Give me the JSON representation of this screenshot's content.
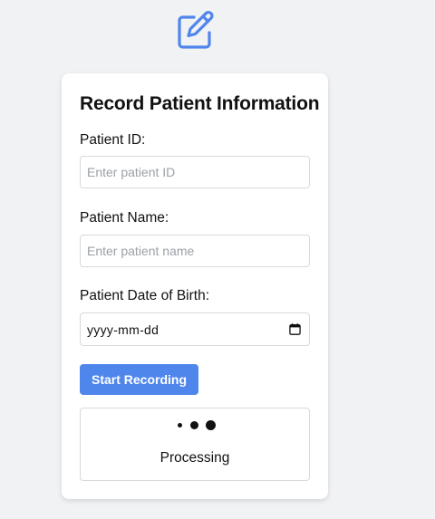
{
  "header": {
    "icon": "pencil-square-icon",
    "accent_color": "#4f86ec"
  },
  "form": {
    "title": "Record Patient Information",
    "patient_id": {
      "label": "Patient ID:",
      "placeholder": "Enter patient ID",
      "value": ""
    },
    "patient_name": {
      "label": "Patient Name:",
      "placeholder": "Enter patient name",
      "value": ""
    },
    "patient_dob": {
      "label": "Patient Date of Birth:",
      "display": "yyyy-mm-dd",
      "icon": "calendar-icon"
    },
    "start_button": {
      "label": "Start Recording",
      "color": "#4f86ec"
    }
  },
  "status": {
    "indicator": "loading-dots-icon",
    "text": "Processing"
  }
}
